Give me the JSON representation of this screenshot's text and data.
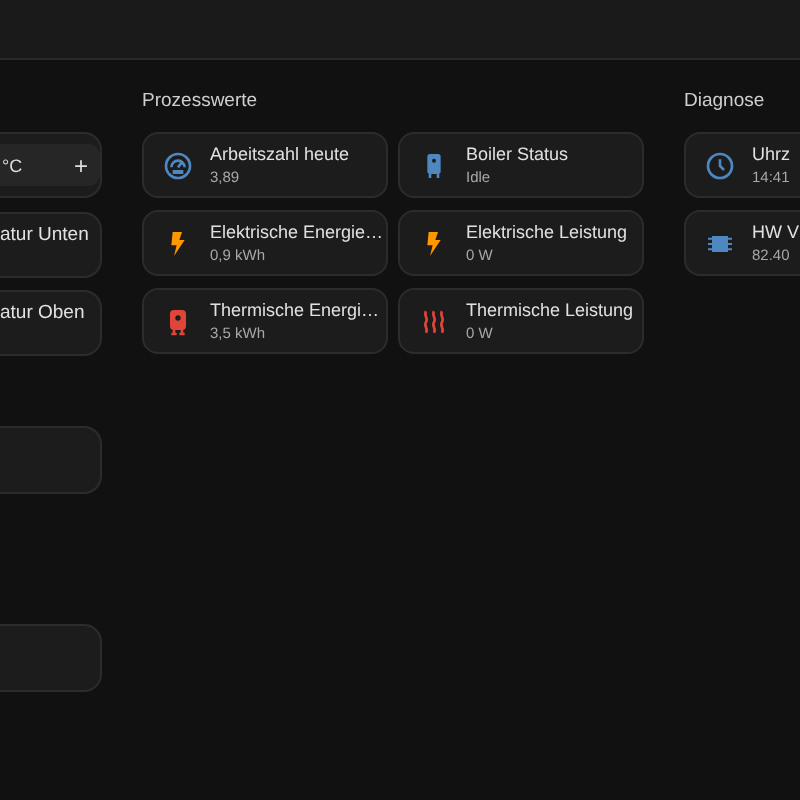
{
  "left_section": {
    "cards": [
      {
        "kind": "input",
        "unit": "°C",
        "button": "+"
      },
      {
        "kind": "label",
        "name": "atur Unten"
      },
      {
        "kind": "label",
        "name": "atur Oben"
      },
      {
        "kind": "empty"
      },
      {
        "kind": "empty"
      }
    ]
  },
  "sections": [
    {
      "title": "Prozesswerte",
      "columns": [
        [
          {
            "kind": "gauge",
            "name": "Arbeitszahl heute",
            "value": "3,89"
          },
          {
            "kind": "bolt",
            "name": "Elektrische Energie…",
            "value": "0,9 kWh"
          },
          {
            "kind": "heater",
            "name": "Thermische Energi…",
            "value": "3,5 kWh"
          }
        ],
        [
          {
            "kind": "boiler",
            "name": "Boiler Status",
            "value": "Idle"
          },
          {
            "kind": "bolt",
            "name": "Elektrische Leistung",
            "value": "0 W"
          },
          {
            "kind": "heat",
            "name": "Thermische Leistung",
            "value": "0 W"
          }
        ]
      ]
    },
    {
      "title": "Diagnose",
      "columns": [
        [
          {
            "kind": "clock",
            "name": "Uhrz",
            "value": "14:41"
          },
          {
            "kind": "chip",
            "name": "HW V",
            "value": "82.40"
          }
        ]
      ]
    }
  ]
}
